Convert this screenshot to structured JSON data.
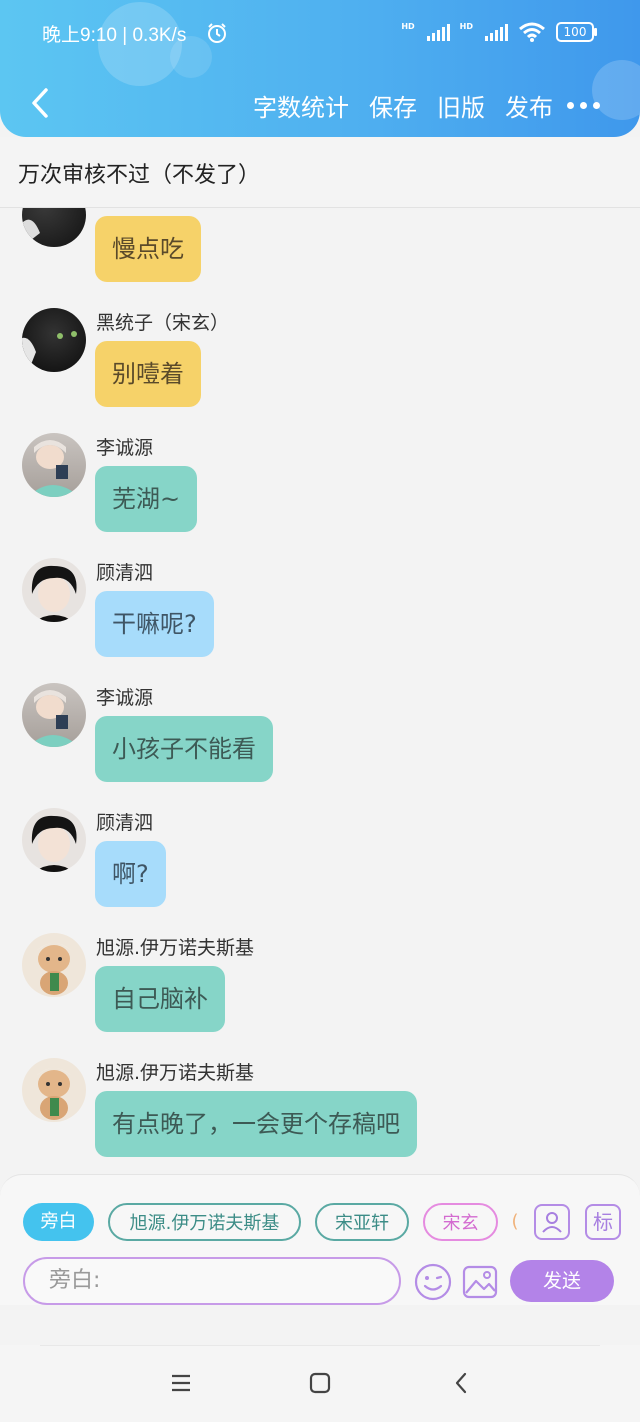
{
  "status_bar": {
    "time_speed": "晚上9:10 | 0.3K/s",
    "battery": "100",
    "hd1": "HD",
    "hd2": "HD"
  },
  "toolbar": {
    "word_count": "字数统计",
    "save": "保存",
    "old_version": "旧版",
    "publish": "发布"
  },
  "story_title": "万次审核不过（不发了）",
  "messages": [
    {
      "name": "",
      "text": "慢点吃",
      "color": "yellow",
      "avatar": "black-cat"
    },
    {
      "name": "黑统子（宋玄）",
      "text": "别噎着",
      "color": "yellow",
      "avatar": "black-cat"
    },
    {
      "name": "李诚源",
      "text": "芜湖~",
      "color": "teal",
      "avatar": "boy-mirror"
    },
    {
      "name": "顾清泗",
      "text": "干嘛呢?",
      "color": "blue",
      "avatar": "boy-dark-hair"
    },
    {
      "name": "李诚源",
      "text": "小孩子不能看",
      "color": "teal",
      "avatar": "boy-mirror"
    },
    {
      "name": "顾清泗",
      "text": "啊?",
      "color": "blue",
      "avatar": "boy-dark-hair"
    },
    {
      "name": "旭源.伊万诺夫斯基",
      "text": "自己脑补",
      "color": "teal",
      "avatar": "cute-bear"
    },
    {
      "name": "旭源.伊万诺夫斯基",
      "text": "有点晚了，一会更个存稿吧",
      "color": "teal",
      "avatar": "cute-bear"
    }
  ],
  "characters": {
    "narration": "旁白",
    "c1": "旭源.伊万诺夫斯基",
    "c2": "宋亚轩",
    "c3": "宋玄",
    "c4": "(",
    "mark_icon": "标"
  },
  "input": {
    "placeholder": "旁白:",
    "send": "发送"
  },
  "colors": {
    "header": "#4fb0f0",
    "yellow_bubble": "#f6d269",
    "teal_bubble": "#86d5c8",
    "blue_bubble": "#a7dcfb",
    "send_button": "#b383e8"
  }
}
